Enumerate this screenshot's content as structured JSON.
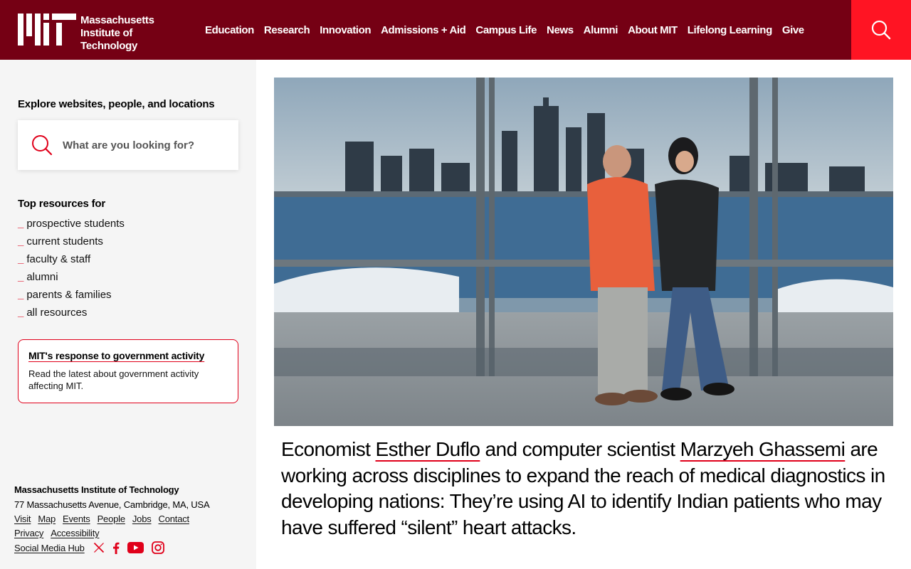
{
  "header": {
    "logo_lines": [
      "Massachusetts",
      "Institute of",
      "Technology"
    ],
    "nav": [
      "Education",
      "Research",
      "Innovation",
      "Admissions + Aid",
      "Campus Life",
      "News",
      "Alumni",
      "About MIT",
      "Lifelong Learning",
      "Give"
    ],
    "search_icon": "search-icon"
  },
  "sidebar": {
    "explore_title": "Explore websites, people, and locations",
    "search_placeholder": "What are you looking for?",
    "resources_title": "Top resources for",
    "resources": [
      "prospective students",
      "current students",
      "faculty & staff",
      "alumni",
      "parents & families",
      "all resources"
    ],
    "notice": {
      "title": "MIT's response to government activity",
      "text": "Read the latest about government activity affecting MIT."
    },
    "footer": {
      "name": "Massachusetts Institute of Technology",
      "address": "77 Massachusetts Avenue, Cambridge, MA, USA",
      "links": [
        "Visit",
        "Map",
        "Events",
        "People",
        "Jobs",
        "Contact",
        "Privacy",
        "Accessibility"
      ],
      "social_hub": "Social Media Hub",
      "social_icons": [
        "x-icon",
        "facebook-icon",
        "youtube-icon",
        "instagram-icon"
      ]
    }
  },
  "main": {
    "caption": {
      "part1": "Economist ",
      "name1": "Esther Duflo",
      "part2": " and computer scientist ",
      "name2": "Marzyeh Ghassemi",
      "part3": " are working across disciplines to expand the reach of medical diagnostics in developing nations: They’re using AI to identify Indian patients who may have suffered “silent” heart attacks."
    }
  },
  "colors": {
    "header_bg": "#750014",
    "accent_red": "#ff1423",
    "link_underline": "#e0001a",
    "sidebar_bg": "#f5f5f5"
  }
}
